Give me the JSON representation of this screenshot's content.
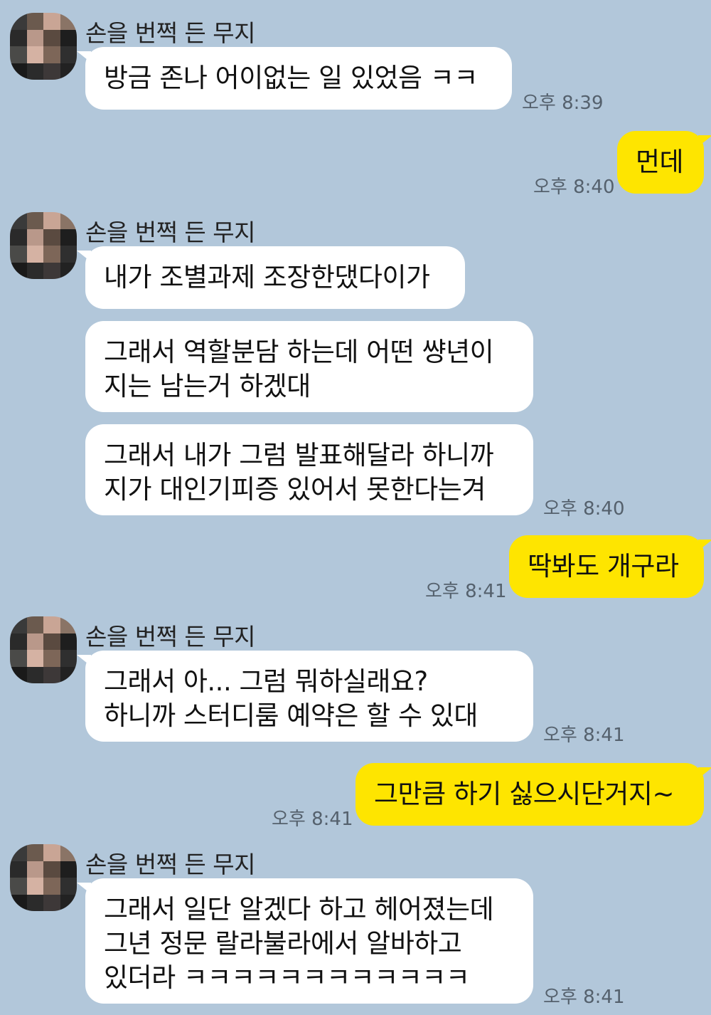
{
  "sender_name": "손을 번쩍 든 무지",
  "messages": [
    {
      "side": "left",
      "lines": [
        "방금 존나 어이없는 일 있었음 ㅋㅋ"
      ],
      "time": "오후 8:39"
    },
    {
      "side": "right",
      "lines": [
        "먼데"
      ],
      "time": "오후 8:40"
    },
    {
      "side": "left",
      "lines": [
        "내가 조별과제 조장한댔다이가"
      ]
    },
    {
      "side": "left",
      "lines": [
        "그래서 역할분담 하는데 어떤 썅년이",
        "지는 남는거 하겠대"
      ]
    },
    {
      "side": "left",
      "lines": [
        "그래서 내가 그럼 발표해달라 하니까",
        "지가 대인기피증 있어서 못한다는겨"
      ],
      "time": "오후 8:40"
    },
    {
      "side": "right",
      "lines": [
        "딱봐도 개구라"
      ],
      "time": "오후 8:41"
    },
    {
      "side": "left",
      "lines": [
        "그래서 아... 그럼 뭐하실래요?",
        "하니까 스터디룸 예약은 할 수 있대"
      ],
      "time": "오후 8:41"
    },
    {
      "side": "right",
      "lines": [
        "그만큼 하기 싫으시단거지~"
      ],
      "time": "오후 8:41"
    },
    {
      "side": "left",
      "lines": [
        "그래서 일단 알겠다 하고 헤어졌는데",
        "그년 정문 랄라불라에서 알바하고",
        "있더라 ㅋㅋㅋㅋㅋㅋㅋㅋㅋㅋㅋㅋ"
      ],
      "time": "오후 8:41"
    }
  ],
  "colors": {
    "background": "#b2c7da",
    "incoming_bubble": "#ffffff",
    "outgoing_bubble": "#fee500",
    "timestamp": "#55616d"
  },
  "icons": {
    "avatar": "pixelated-profile-photo"
  }
}
